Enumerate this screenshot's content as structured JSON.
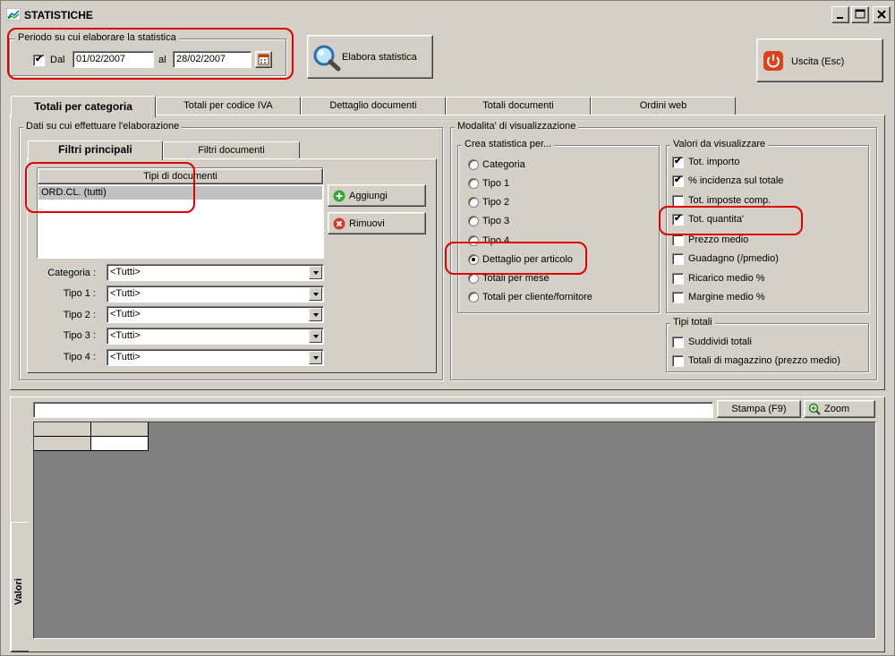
{
  "window": {
    "title": "STATISTICHE"
  },
  "period": {
    "group_label": "Periodo su cui elaborare la statistica",
    "dal_checked": true,
    "dal_label": "Dal",
    "date_from": "01/02/2007",
    "al_label": "al",
    "date_to": "28/02/2007"
  },
  "toolbar": {
    "elabora_label": "Elabora statistica",
    "uscita_label": "Uscita (Esc)"
  },
  "main_tabs": [
    {
      "label": "Totali per categoria",
      "active": true
    },
    {
      "label": "Totali per codice IVA",
      "active": false
    },
    {
      "label": "Dettaglio documenti",
      "active": false
    },
    {
      "label": "Totali documenti",
      "active": false
    },
    {
      "label": "Ordini web",
      "active": false
    }
  ],
  "data_group": {
    "label": "Dati su cui effettuare l'elaborazione",
    "sub_tabs": [
      {
        "label": "Filtri principali",
        "active": true
      },
      {
        "label": "Filtri documenti",
        "active": false
      }
    ],
    "doc_types_header": "Tipi di documenti",
    "doc_types": [
      "ORD.CL. (tutti)"
    ],
    "add_label": "Aggiungi",
    "remove_label": "Rimuovi",
    "filters": [
      {
        "label": "Categoria :",
        "value": "<Tutti>"
      },
      {
        "label": "Tipo 1 :",
        "value": "<Tutti>"
      },
      {
        "label": "Tipo 2 :",
        "value": "<Tutti>"
      },
      {
        "label": "Tipo 3 :",
        "value": "<Tutti>"
      },
      {
        "label": "Tipo 4 :",
        "value": "<Tutti>"
      }
    ]
  },
  "view_group": {
    "label": "Modalita' di visualizzazione",
    "crea": {
      "label": "Crea statistica per...",
      "options": [
        {
          "label": "Categoria",
          "selected": false
        },
        {
          "label": "Tipo 1",
          "selected": false
        },
        {
          "label": "Tipo 2",
          "selected": false
        },
        {
          "label": "Tipo 3",
          "selected": false
        },
        {
          "label": "Tipo 4",
          "selected": false
        },
        {
          "label": "Dettaglio per articolo",
          "selected": true
        },
        {
          "label": "Totali per mese",
          "selected": false
        },
        {
          "label": "Totali per cliente/fornitore",
          "selected": false
        }
      ]
    },
    "valori": {
      "label": "Valori da visualizzare",
      "options": [
        {
          "label": "Tot. importo",
          "checked": true
        },
        {
          "label": "% incidenza sul totale",
          "checked": true
        },
        {
          "label": "Tot. imposte comp.",
          "checked": false
        },
        {
          "label": "Tot. quantita'",
          "checked": true
        },
        {
          "label": "Prezzo medio",
          "checked": false
        },
        {
          "label": "Guadagno (/pmedio)",
          "checked": false
        },
        {
          "label": "Ricarico medio %",
          "checked": false
        },
        {
          "label": "Margine medio %",
          "checked": false
        }
      ]
    },
    "tipi_totali": {
      "label": "Tipi totali",
      "options": [
        {
          "label": "Suddividi totali",
          "checked": false
        },
        {
          "label": "Totali di magazzino (prezzo medio)",
          "checked": false
        }
      ]
    }
  },
  "results": {
    "side_tab_label": "Valori",
    "search_value": "",
    "stampa_label": "Stampa (F9)",
    "zoom_label": "Zoom"
  },
  "colors": {
    "face": "#d4d0c8",
    "grid_bg": "#808080",
    "highlight_red": "#e00000",
    "selection": "#c0c0c0"
  }
}
